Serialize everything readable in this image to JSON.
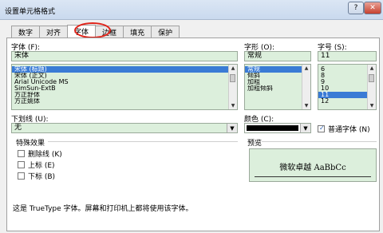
{
  "window": {
    "title": "设置单元格格式",
    "help_label": "?",
    "close_label": "✕"
  },
  "tabs": [
    {
      "label": "数字"
    },
    {
      "label": "对齐"
    },
    {
      "label": "字体"
    },
    {
      "label": "边框"
    },
    {
      "label": "填充"
    },
    {
      "label": "保护"
    }
  ],
  "font": {
    "label": "字体 (F):",
    "value": "宋体",
    "items": [
      {
        "label": "宋体 (标题)",
        "selected": true
      },
      {
        "label": "宋体 (正文)"
      },
      {
        "label": "Arial Unicode MS"
      },
      {
        "label": "SimSun-ExtB"
      },
      {
        "label": "方正舒体"
      },
      {
        "label": "方正姚体"
      }
    ]
  },
  "style": {
    "label": "字形 (O):",
    "value": "常规",
    "items": [
      {
        "label": "常规",
        "selected": true
      },
      {
        "label": "倾斜"
      },
      {
        "label": "加粗"
      },
      {
        "label": "加粗倾斜"
      }
    ]
  },
  "size": {
    "label": "字号 (S):",
    "value": "11",
    "items": [
      {
        "label": "6"
      },
      {
        "label": "8"
      },
      {
        "label": "9"
      },
      {
        "label": "10"
      },
      {
        "label": "11",
        "selected": true
      },
      {
        "label": "12"
      }
    ]
  },
  "underline": {
    "label": "下划线 (U):",
    "value": "无"
  },
  "color": {
    "label": "颜色 (C):",
    "swatch": "#000000",
    "normal_font_label": "普通字体 (N)",
    "normal_font_checked": true
  },
  "effects": {
    "label": "特殊效果",
    "items": [
      {
        "label": "删除线 (K)"
      },
      {
        "label": "上标 (E)"
      },
      {
        "label": "下标 (B)"
      }
    ]
  },
  "preview": {
    "label": "预览",
    "text": "微软卓越  AaBbCc"
  },
  "info_text": "这是 TrueType 字体。屏幕和打印机上都将使用该字体。",
  "colors": {
    "highlight": "#e0241a",
    "selection": "#3a7bd5",
    "field_bg": "#dcefdc"
  }
}
